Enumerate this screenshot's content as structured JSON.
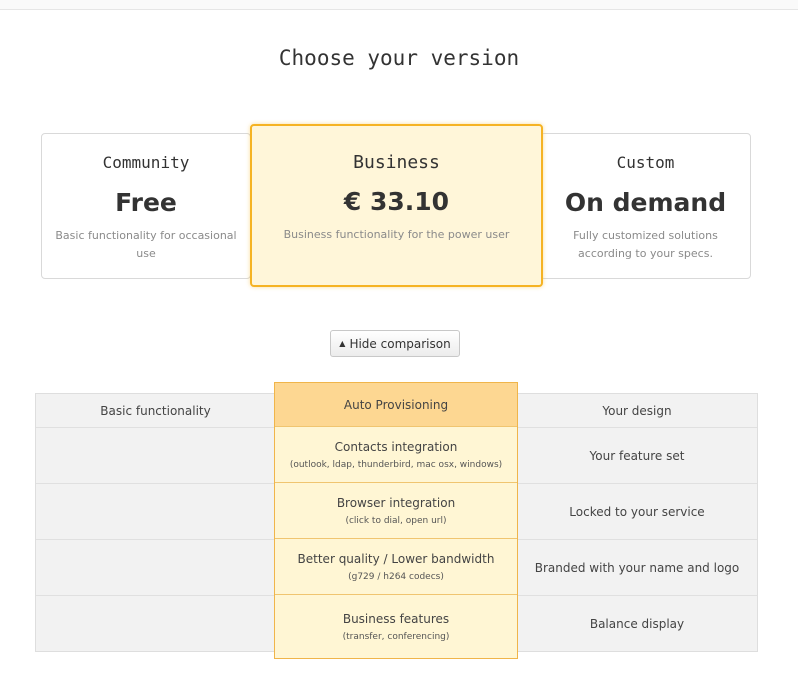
{
  "page": {
    "title": "Choose your version"
  },
  "plans": [
    {
      "name": "Community",
      "price": "Free",
      "desc_line1": "Basic functionality for occasional",
      "desc_line2": "use"
    },
    {
      "name": "Business",
      "price": "€ 33.10",
      "desc_line1": "Business functionality for the power user",
      "desc_line2": ""
    },
    {
      "name": "Custom",
      "price": "On demand",
      "desc_line1": "Fully customized solutions",
      "desc_line2": "according to your specs."
    }
  ],
  "comparison_button": {
    "icon": "caret-up-icon",
    "label": "Hide comparison"
  },
  "comparison": {
    "community": [
      "Basic functionality",
      "",
      "",
      "",
      ""
    ],
    "business": [
      {
        "main": "Auto Provisioning",
        "sub": ""
      },
      {
        "main": "Contacts integration",
        "sub": "(outlook, ldap, thunderbird, mac osx, windows)"
      },
      {
        "main": "Browser integration",
        "sub": "(click to dial, open url)"
      },
      {
        "main": "Better quality / Lower bandwidth",
        "sub": "(g729 / h264 codecs)"
      },
      {
        "main": "Business features",
        "sub": "(transfer, conferencing)"
      }
    ],
    "custom": [
      "Your design",
      "Your feature set",
      "Locked to your service",
      "Branded with your name and logo",
      "Balance display"
    ]
  },
  "colors": {
    "highlight_border": "#f5b324",
    "highlight_bg": "#fff6d9",
    "header_bg": "#fdd792"
  }
}
